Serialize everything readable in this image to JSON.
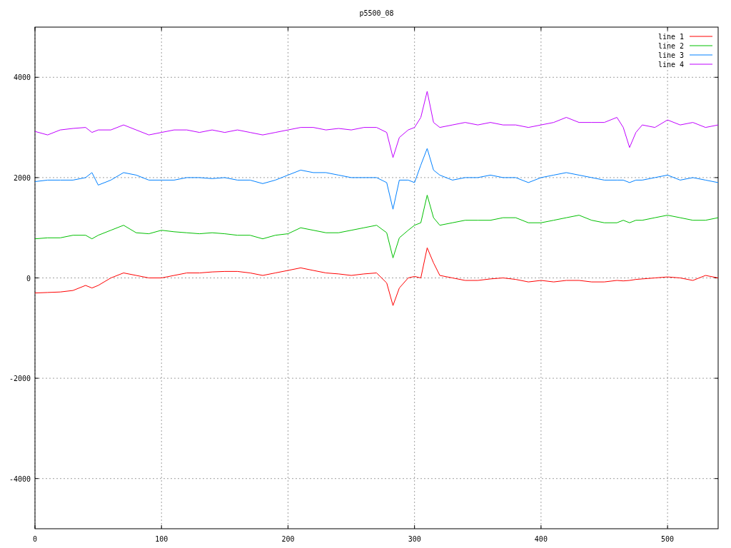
{
  "chart": {
    "chart_data": {
      "type": "line",
      "title": "p5500_08",
      "x": [
        0,
        10,
        20,
        30,
        40,
        45,
        50,
        60,
        70,
        80,
        90,
        100,
        110,
        120,
        130,
        140,
        150,
        160,
        170,
        180,
        190,
        200,
        210,
        220,
        230,
        240,
        250,
        260,
        270,
        278,
        283,
        288,
        295,
        300,
        305,
        310,
        315,
        320,
        330,
        340,
        350,
        360,
        370,
        380,
        390,
        400,
        410,
        420,
        430,
        440,
        450,
        460,
        465,
        470,
        475,
        480,
        490,
        500,
        510,
        520,
        530,
        540
      ],
      "series": [
        {
          "name": "line 1",
          "color": "#ff0000",
          "values": [
            -300,
            -290,
            -280,
            -250,
            -150,
            -200,
            -150,
            0,
            100,
            50,
            0,
            0,
            50,
            100,
            100,
            120,
            130,
            130,
            100,
            50,
            100,
            150,
            200,
            150,
            100,
            80,
            50,
            80,
            100,
            -100,
            -550,
            -200,
            0,
            30,
            0,
            600,
            300,
            50,
            0,
            -50,
            -50,
            -20,
            0,
            -30,
            -80,
            -50,
            -80,
            -50,
            -50,
            -80,
            -80,
            -50,
            -60,
            -50,
            -30,
            -20,
            0,
            20,
            0,
            -50,
            50,
            0
          ]
        },
        {
          "name": "line 2",
          "color": "#00c000",
          "values": [
            780,
            800,
            800,
            850,
            850,
            780,
            850,
            950,
            1050,
            900,
            880,
            950,
            920,
            900,
            880,
            900,
            880,
            850,
            850,
            780,
            850,
            880,
            1000,
            950,
            900,
            900,
            950,
            1000,
            1050,
            900,
            400,
            800,
            950,
            1050,
            1100,
            1650,
            1200,
            1050,
            1100,
            1150,
            1150,
            1150,
            1200,
            1200,
            1100,
            1100,
            1150,
            1200,
            1250,
            1150,
            1100,
            1100,
            1150,
            1100,
            1150,
            1150,
            1200,
            1250,
            1200,
            1150,
            1150,
            1200
          ]
        },
        {
          "name": "line 3",
          "color": "#0080ff",
          "values": [
            1920,
            1950,
            1950,
            1950,
            2000,
            2100,
            1850,
            1950,
            2100,
            2050,
            1950,
            1950,
            1950,
            2000,
            2000,
            1980,
            2000,
            1950,
            1950,
            1880,
            1950,
            2050,
            2150,
            2100,
            2100,
            2050,
            2000,
            2000,
            2000,
            1900,
            1370,
            1950,
            1950,
            1900,
            2250,
            2580,
            2150,
            2050,
            1950,
            2000,
            2000,
            2050,
            2000,
            2000,
            1900,
            2000,
            2050,
            2100,
            2050,
            2000,
            1950,
            1950,
            1950,
            1900,
            1950,
            1950,
            2000,
            2050,
            1950,
            2000,
            1950,
            1900
          ]
        },
        {
          "name": "line 4",
          "color": "#c000ff",
          "values": [
            2920,
            2850,
            2950,
            2980,
            3000,
            2900,
            2950,
            2950,
            3050,
            2950,
            2850,
            2900,
            2950,
            2950,
            2900,
            2950,
            2900,
            2950,
            2900,
            2850,
            2900,
            2950,
            3000,
            3000,
            2950,
            2980,
            2950,
            3000,
            3000,
            2900,
            2400,
            2800,
            2950,
            3000,
            3200,
            3720,
            3100,
            3000,
            3050,
            3100,
            3050,
            3100,
            3050,
            3050,
            3000,
            3050,
            3100,
            3200,
            3100,
            3100,
            3100,
            3200,
            3000,
            2600,
            2900,
            3050,
            3000,
            3150,
            3050,
            3100,
            3000,
            3050
          ]
        }
      ],
      "grid": true,
      "legend": true,
      "xlim": [
        0,
        540
      ],
      "ylim": [
        -5000,
        5000
      ],
      "xticks": [
        0,
        100,
        200,
        300,
        400,
        500
      ],
      "yticks": [
        {
          "value": -4000,
          "label": "-4000"
        },
        {
          "value": -2000,
          "label": "-2000"
        },
        {
          "value": 0,
          "label": "0"
        },
        {
          "value": 2000,
          "label": "2000"
        },
        {
          "value": 4000,
          "label": "4000"
        }
      ]
    }
  }
}
